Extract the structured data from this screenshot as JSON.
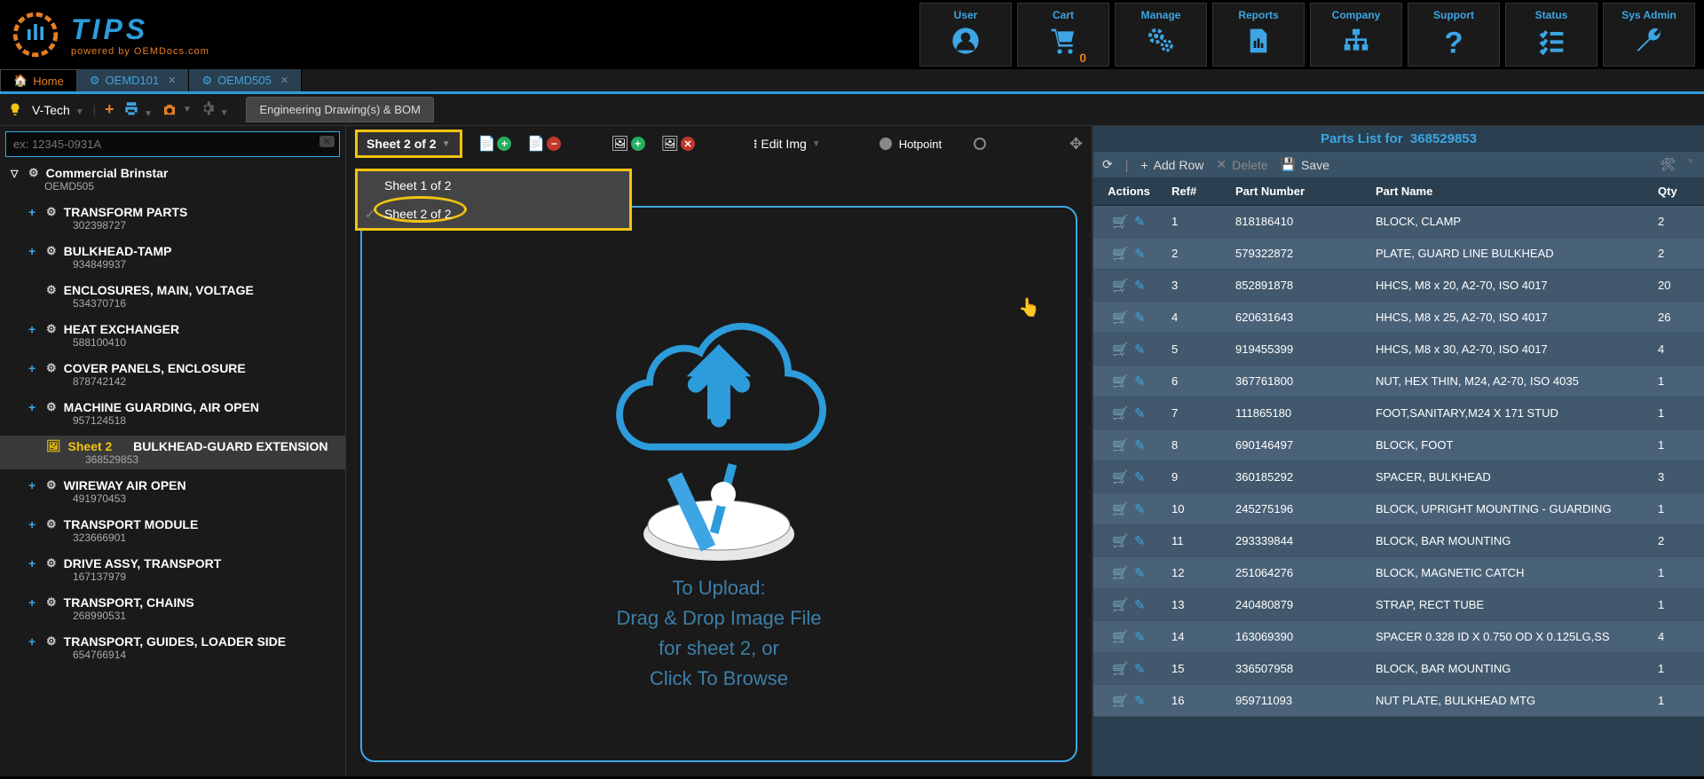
{
  "logo": {
    "title": "TIPS",
    "subtitle": "powered by OEMDocs.com"
  },
  "nav_tiles": [
    {
      "label": "User",
      "icon": "user"
    },
    {
      "label": "Cart",
      "icon": "cart",
      "badge": "0"
    },
    {
      "label": "Manage",
      "icon": "gears"
    },
    {
      "label": "Reports",
      "icon": "report"
    },
    {
      "label": "Company",
      "icon": "org"
    },
    {
      "label": "Support",
      "icon": "question"
    },
    {
      "label": "Status",
      "icon": "checklist"
    },
    {
      "label": "Sys Admin",
      "icon": "wrench"
    }
  ],
  "tabs": [
    {
      "label": "Home",
      "home": true
    },
    {
      "label": "OEMD101",
      "closable": true
    },
    {
      "label": "OEMD505",
      "closable": true
    }
  ],
  "toolbar": {
    "vtech": "V-Tech",
    "sub_tab": "Engineering Drawing(s) & BOM"
  },
  "search": {
    "placeholder": "ex: 12345-0931A"
  },
  "tree": {
    "root": {
      "title": "Commercial Brinstar",
      "code": "OEMD505"
    },
    "children": [
      {
        "title": "TRANSFORM PARTS",
        "code": "302398727"
      },
      {
        "title": "BULKHEAD-TAMP",
        "code": "934849937"
      },
      {
        "title": "ENCLOSURES, MAIN, VOLTAGE",
        "code": "534370716",
        "no_plus": true
      },
      {
        "title": "HEAT EXCHANGER",
        "code": "588100410"
      },
      {
        "title": "COVER PANELS, ENCLOSURE",
        "code": "878742142"
      },
      {
        "title": "MACHINE GUARDING, AIR OPEN",
        "code": "957124518"
      },
      {
        "sheet": "Sheet 2",
        "title": "BULKHEAD-GUARD EXTENSION",
        "code": "368529853",
        "selected": true
      },
      {
        "title": "WIREWAY AIR OPEN",
        "code": "491970453"
      },
      {
        "title": "TRANSPORT MODULE",
        "code": "323666901"
      },
      {
        "title": "DRIVE ASSY, TRANSPORT",
        "code": "167137979"
      },
      {
        "title": "TRANSPORT, CHAINS",
        "code": "268990531"
      },
      {
        "title": "TRANSPORT, GUIDES, LOADER SIDE",
        "code": "654766914"
      }
    ]
  },
  "canvas": {
    "sheet_selector": "Sheet 2 of 2",
    "dropdown": [
      {
        "label": "Sheet 1 of 2"
      },
      {
        "label": "Sheet 2 of 2",
        "selected": true
      }
    ],
    "edit_img": "Edit Img",
    "hotpoint": "Hotpoint",
    "upload": {
      "line1": "To Upload:",
      "line2": "Drag & Drop Image File",
      "line3": "for sheet 2, or",
      "line4": "Click To Browse"
    }
  },
  "parts": {
    "header_prefix": "Parts List for",
    "header_number": "368529853",
    "toolbar": {
      "add": "Add Row",
      "delete": "Delete",
      "save": "Save"
    },
    "columns": {
      "actions": "Actions",
      "ref": "Ref#",
      "pn": "Part Number",
      "name": "Part Name",
      "qty": "Qty"
    },
    "rows": [
      {
        "ref": "1",
        "pn": "818186410",
        "name": "BLOCK, CLAMP",
        "qty": "2"
      },
      {
        "ref": "2",
        "pn": "579322872",
        "name": "PLATE, GUARD LINE BULKHEAD",
        "qty": "2"
      },
      {
        "ref": "3",
        "pn": "852891878",
        "name": "HHCS, M8 x 20, A2-70, ISO 4017",
        "qty": "20"
      },
      {
        "ref": "4",
        "pn": "620631643",
        "name": "HHCS, M8 x 25, A2-70, ISO 4017",
        "qty": "26"
      },
      {
        "ref": "5",
        "pn": "919455399",
        "name": "HHCS, M8 x 30, A2-70, ISO 4017",
        "qty": "4"
      },
      {
        "ref": "6",
        "pn": "367761800",
        "name": "NUT, HEX THIN, M24, A2-70, ISO 4035",
        "qty": "1"
      },
      {
        "ref": "7",
        "pn": "111865180",
        "name": "FOOT,SANITARY,M24 X 171 STUD",
        "qty": "1"
      },
      {
        "ref": "8",
        "pn": "690146497",
        "name": "BLOCK, FOOT",
        "qty": "1"
      },
      {
        "ref": "9",
        "pn": "360185292",
        "name": "SPACER, BULKHEAD",
        "qty": "3"
      },
      {
        "ref": "10",
        "pn": "245275196",
        "name": "BLOCK, UPRIGHT MOUNTING - GUARDING",
        "qty": "1"
      },
      {
        "ref": "11",
        "pn": "293339844",
        "name": "BLOCK, BAR MOUNTING",
        "qty": "2"
      },
      {
        "ref": "12",
        "pn": "251064276",
        "name": "BLOCK, MAGNETIC CATCH",
        "qty": "1"
      },
      {
        "ref": "13",
        "pn": "240480879",
        "name": "STRAP, RECT TUBE",
        "qty": "1"
      },
      {
        "ref": "14",
        "pn": "163069390",
        "name": "SPACER 0.328 ID X 0.750 OD X 0.125LG,SS",
        "qty": "4"
      },
      {
        "ref": "15",
        "pn": "336507958",
        "name": "BLOCK, BAR MOUNTING",
        "qty": "1"
      },
      {
        "ref": "16",
        "pn": "959711093",
        "name": "NUT PLATE, BULKHEAD MTG",
        "qty": "1"
      }
    ]
  }
}
